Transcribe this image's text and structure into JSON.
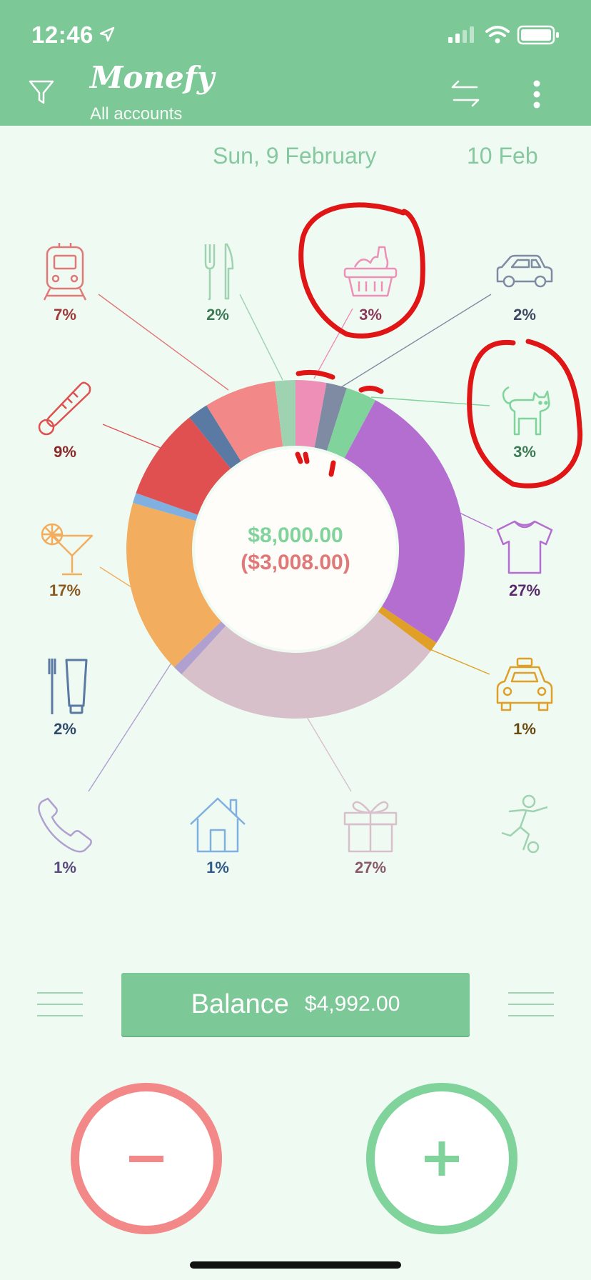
{
  "status": {
    "time": "12:46"
  },
  "header": {
    "title": "Monefy",
    "subtitle": "All accounts"
  },
  "dates": {
    "current": "Sun, 9 February",
    "next": "10 Feb"
  },
  "categories": [
    {
      "name": "transport",
      "icon": "train-icon",
      "pct": "7%",
      "color": "#e07878"
    },
    {
      "name": "eating-out",
      "icon": "fork-knife-icon",
      "pct": "2%",
      "color": "#9fd2b0"
    },
    {
      "name": "food",
      "icon": "basket-icon",
      "pct": "3%",
      "color": "#ee8fb8"
    },
    {
      "name": "car",
      "icon": "car-icon",
      "pct": "2%",
      "color": "#7f8aa3"
    },
    {
      "name": "health",
      "icon": "thermometer-icon",
      "pct": "9%",
      "color": "#e05050"
    },
    {
      "name": "pets",
      "icon": "cat-icon",
      "pct": "3%",
      "color": "#7fd39b"
    },
    {
      "name": "entertainment",
      "icon": "cocktail-icon",
      "pct": "17%",
      "color": "#f2ae5e"
    },
    {
      "name": "clothes",
      "icon": "tshirt-icon",
      "pct": "27%",
      "color": "#b46ed0"
    },
    {
      "name": "toiletry",
      "icon": "toothbrush-icon",
      "pct": "2%",
      "color": "#5a7aa3"
    },
    {
      "name": "taxi",
      "icon": "taxi-icon",
      "pct": "1%",
      "color": "#e0a028"
    },
    {
      "name": "communications",
      "icon": "phone-icon",
      "pct": "1%",
      "color": "#b0a0d0"
    },
    {
      "name": "house",
      "icon": "house-icon",
      "pct": "1%",
      "color": "#7fb0e0"
    },
    {
      "name": "gifts",
      "icon": "gift-icon",
      "pct": "27%",
      "color": "#d8c0cb"
    },
    {
      "name": "sports",
      "icon": "soccer-icon",
      "pct": "",
      "color": "#9fd2b0"
    }
  ],
  "chart_data": {
    "type": "pie",
    "income_label": "$8,000.00",
    "expense_label": "($3,008.00)",
    "slices": [
      {
        "category": "food",
        "value": 3,
        "color": "#ee8fb8"
      },
      {
        "category": "car",
        "value": 2,
        "color": "#7f8aa3"
      },
      {
        "category": "pets",
        "value": 3,
        "color": "#7fd39b"
      },
      {
        "category": "clothes",
        "value": 27,
        "color": "#b46ed0"
      },
      {
        "category": "taxi",
        "value": 1,
        "color": "#e0a028"
      },
      {
        "category": "gifts",
        "value": 27,
        "color": "#d8c0cb"
      },
      {
        "category": "communications",
        "value": 1,
        "color": "#b0a0d0"
      },
      {
        "category": "entertainment",
        "value": 17,
        "color": "#f2ae5e"
      },
      {
        "category": "house",
        "value": 1,
        "color": "#7fb0e0"
      },
      {
        "category": "health",
        "value": 9,
        "color": "#e05050"
      },
      {
        "category": "toiletry",
        "value": 2,
        "color": "#5a7aa3"
      },
      {
        "category": "transport",
        "value": 7,
        "color": "#f28888"
      },
      {
        "category": "eating-out",
        "value": 2,
        "color": "#9fd2b0"
      }
    ]
  },
  "balance": {
    "label": "Balance",
    "value": "$4,992.00"
  },
  "actions": {
    "minus": "−",
    "plus": "+"
  }
}
